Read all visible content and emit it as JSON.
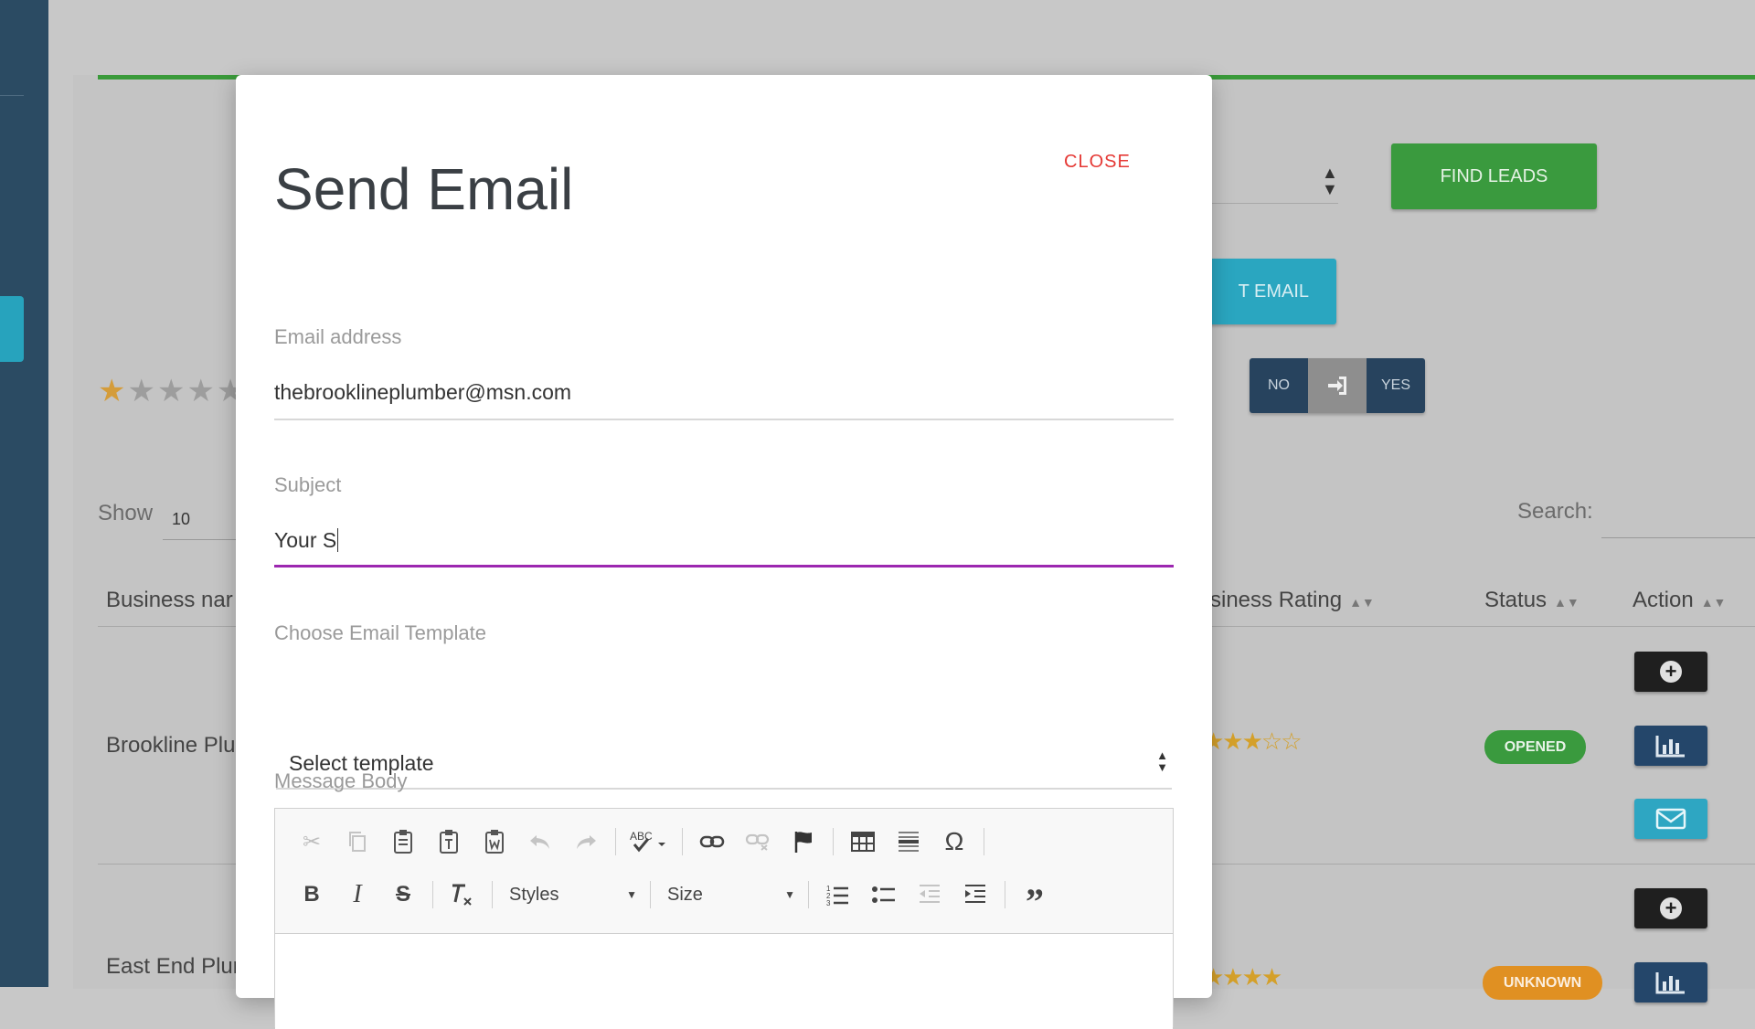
{
  "background": {
    "find_leads_label": "FIND LEADS",
    "export_email_label": "T EMAIL",
    "toggle": {
      "no": "NO",
      "mid_icon": "sign-in-icon",
      "yes": "YES"
    },
    "stars": {
      "filled": "★",
      "empty": "★★★★"
    },
    "show_label": "Show",
    "show_value": "10",
    "search_label": "Search:",
    "headers": {
      "business_name": "Business nar",
      "business_rating": "siness Rating",
      "status": "Status",
      "action": "Action"
    },
    "rows": [
      {
        "name": "Brookline Plu",
        "rating": "★★★☆☆",
        "status": "OPENED"
      },
      {
        "name": "East End Plur",
        "rating": "★★★★",
        "status": "UNKNOWN"
      }
    ],
    "colors": {
      "find_leads": "#3a9a3e",
      "export": "#2aa6c0",
      "rail": "#2b4b63",
      "opened": "#3a9a3e",
      "unknown": "#e09022"
    }
  },
  "modal": {
    "title": "Send Email",
    "close_label": "CLOSE",
    "email_label": "Email address",
    "email_value": "thebrooklineplumber@msn.com",
    "subject_label": "Subject",
    "subject_value": "Your S",
    "template_label": "Choose Email Template",
    "template_value": "Select template",
    "message_label": "Message Body",
    "toolbar_row1": [
      "cut-icon",
      "copy-icon",
      "paste-icon",
      "paste-text-icon",
      "paste-word-icon",
      "undo-icon",
      "redo-icon",
      "spellcheck-icon",
      "link-icon",
      "unlink-icon",
      "anchor-icon",
      "table-icon",
      "horizontal-line-icon",
      "special-char-icon"
    ],
    "toolbar_row2": [
      "bold-icon",
      "italic-icon",
      "strike-icon",
      "remove-format-icon",
      "numbered-list-icon",
      "bulleted-list-icon",
      "outdent-icon",
      "indent-icon",
      "blockquote-icon"
    ],
    "styles_label": "Styles",
    "size_label": "Size",
    "accent_color": "#9c27b0",
    "close_color": "#e53935"
  }
}
